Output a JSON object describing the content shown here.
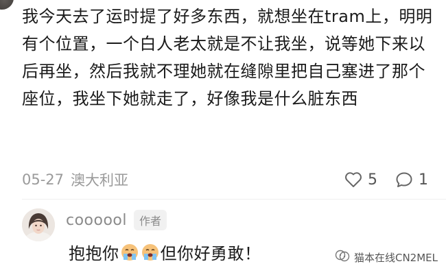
{
  "post": {
    "text": "我今天去了运时提了好多东西，就想坐在tram上，明明有个位置，一个白人老太就是不让我坐，说等她下来以后再坐，然后我就不理她就在缝隙里把自己塞进了那个座位，我坐下她就走了，好像我是什么脏东西",
    "date": "05-27",
    "location": "澳大利亚",
    "like_count": "5",
    "comment_count": "1"
  },
  "reply": {
    "username": "coooool",
    "badge": "作者",
    "text_before": "抱抱你",
    "text_after": "但你好勇敢！",
    "emoji": "crying-face-emoji"
  },
  "watermark": {
    "text": "猫本在线CN2MEL",
    "icon": "wechat-channel-icon"
  }
}
